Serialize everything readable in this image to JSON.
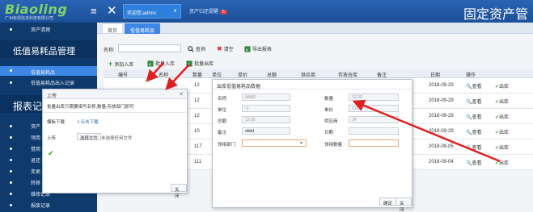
{
  "header": {
    "logo": "Biaoling",
    "logo_sub": "广州标领信息科技有限公司",
    "welcome": "欢迎您,admin",
    "alarm": "资产归还提醒",
    "alarm_count": "6",
    "title": "固定资产管"
  },
  "sidebar": {
    "top_item": "资产清理",
    "section1": "低值易耗品管理",
    "section1_items": [
      "低值易耗品",
      "低值易耗品出入记录"
    ],
    "section2": "报表记录",
    "section2_items": [
      "资产",
      "领用",
      "借用",
      "退还",
      "变更",
      "转移",
      "维修记录",
      "报废记录"
    ]
  },
  "tabs": [
    "首页",
    "低值易耗品"
  ],
  "toolbar": {
    "name_label": "名称:",
    "query": "查询",
    "clear": "清空",
    "export": "导出报表",
    "add": "添加入库",
    "batch_in": "批量入库",
    "batch_out": "批量出库"
  },
  "table": {
    "headers": [
      "编号",
      "名称",
      "数量",
      "单位",
      "单价",
      "总额",
      "供应商",
      "存放仓库",
      "备注",
      "日期",
      "操作"
    ],
    "rows": [
      {
        "qty": "12",
        "date": "2018-09-29"
      },
      {
        "qty": "12",
        "date": "2018-09-29"
      },
      {
        "qty": "12",
        "date": "2018-09-29"
      },
      {
        "qty": "10",
        "date": "2018-09-29"
      },
      {
        "qty": "117",
        "date": "2018-09-05"
      },
      {
        "qty": "111",
        "date": "2018-09-04"
      }
    ],
    "view": "查看",
    "out": "出库"
  },
  "upload_dialog": {
    "title": "上传",
    "hint": "批量出库只需要填写名称,数量,存放部门即可",
    "template_label": "模板下载",
    "download": "点击下载",
    "upload_label": "上传",
    "choose_file": "选择文件",
    "no_file": "未选择任何文件",
    "close": "关闭"
  },
  "out_dialog": {
    "title": "出库低值易耗品数据",
    "name_label": "名称",
    "name_value": "AAAD",
    "qty_label": "数量",
    "qty_value": "12.00",
    "unit_label": "单位",
    "unit_value": "个",
    "price_label": "单价",
    "price_value": "1.00",
    "total_label": "总额",
    "total_value": "12.00",
    "supplier_label": "供应商",
    "supplier_value": "24",
    "note_label": "备注",
    "note_value": "dddd",
    "date_label": "日期",
    "dept_label": "领用部门",
    "outqty_label": "领用数量",
    "confirm": "确定",
    "close": "关闭"
  },
  "colors": {
    "topbar": "#1d4f99",
    "sidebar": "#0f3a6d",
    "accent": "#3f87e5",
    "arrow": "#e02020"
  }
}
